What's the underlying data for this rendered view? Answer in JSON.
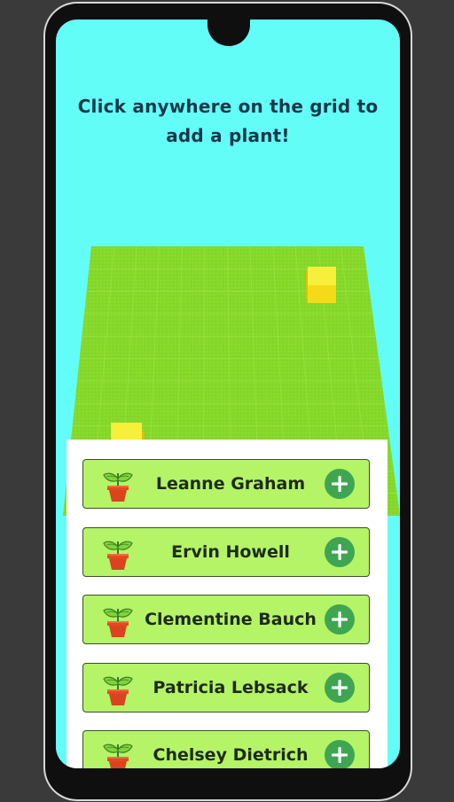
{
  "app": {
    "instruction": "Click anywhere on the grid to add a plant!"
  },
  "users": [
    {
      "name": "Leanne Graham",
      "icon": "potted-plant-icon",
      "action_icon": "plus-icon"
    },
    {
      "name": "Ervin Howell",
      "icon": "potted-plant-icon",
      "action_icon": "plus-icon"
    },
    {
      "name": "Clementine Bauch",
      "icon": "potted-plant-icon",
      "action_icon": "plus-icon"
    },
    {
      "name": "Patricia Lebsack",
      "icon": "potted-plant-icon",
      "action_icon": "plus-icon"
    },
    {
      "name": "Chelsey Dietrich",
      "icon": "potted-plant-icon",
      "action_icon": "plus-icon"
    }
  ],
  "colors": {
    "screen_background": "#63fdf8",
    "grid_green": "#86d82a",
    "card_green": "#b4f466",
    "add_button": "#3fa553",
    "block_yellow": "#f6e82b",
    "pot": "#d9441f"
  }
}
